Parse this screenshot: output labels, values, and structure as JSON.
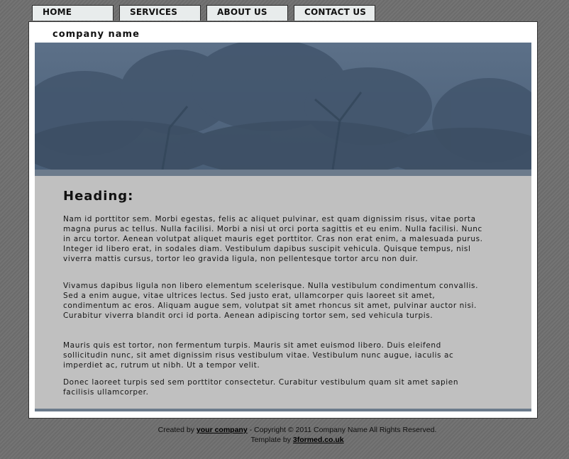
{
  "nav": {
    "items": [
      {
        "label": "HOME"
      },
      {
        "label": "SERVICES"
      },
      {
        "label": "ABOUT US"
      },
      {
        "label": "CONTACT US"
      }
    ]
  },
  "header": {
    "company_name": "company name"
  },
  "main": {
    "heading": "Heading:",
    "paragraphs": [
      "Nam id porttitor sem. Morbi egestas, felis ac aliquet pulvinar, est quam dignissim risus, vitae porta magna purus ac tellus. Nulla facilisi. Morbi a nisi ut orci porta sagittis et eu enim. Nulla facilisi. Nunc in arcu tortor. Aenean volutpat aliquet mauris eget porttitor. Cras non erat enim, a malesuada purus. Integer id libero erat, in sodales diam. Vestibulum dapibus suscipit vehicula. Quisque tempus, nisl viverra mattis cursus, tortor leo gravida ligula, non pellentesque tortor arcu non duir.",
      "Vivamus dapibus ligula non libero elementum scelerisque. Nulla vestibulum condimentum convallis. Sed a enim augue, vitae ultrices lectus. Sed justo erat, ullamcorper quis laoreet sit amet, condimentum ac eros. Aliquam augue sem, volutpat sit amet rhoncus sit amet, pulvinar auctor nisi. Curabitur viverra blandit orci id porta. Aenean adipiscing tortor sem, sed vehicula turpis.",
      "Mauris quis est tortor, non fermentum turpis. Mauris sit amet euismod libero. Duis eleifend sollicitudin nunc, sit amet dignissim risus vestibulum vitae. Vestibulum nunc augue, iaculis ac imperdiet ac, rutrum ut nibh. Ut a tempor velit.",
      "Donec laoreet turpis sed sem porttitor consectetur. Curabitur vestibulum quam sit amet sapien facilisis ullamcorper."
    ]
  },
  "footer": {
    "created_by": "Created by",
    "company_link": "your company",
    "copyright": "- Copyright © 2011 Company Name All Rights Reserved.",
    "template_by": "Template by",
    "template_link": "3formed.co.uk"
  },
  "colors": {
    "page_background": "#6f6f6f",
    "banner": "#4f6580",
    "accent_bar": "#6c7b8c",
    "content_background": "#c0c0c0",
    "tab_background": "#e8ecec"
  }
}
